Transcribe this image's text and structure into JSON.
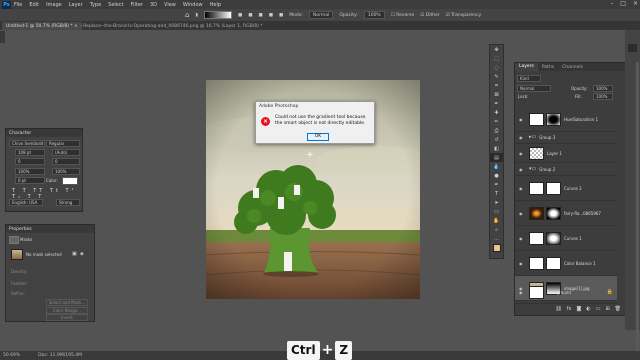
{
  "menubar": {
    "app_icon": "Ps",
    "items": [
      "File",
      "Edit",
      "Image",
      "Layer",
      "Type",
      "Select",
      "Filter",
      "3D",
      "View",
      "Window",
      "Help"
    ]
  },
  "options": {
    "mode_label": "Mode:",
    "mode_value": "Normal",
    "opacity_label": "Opacity:",
    "opacity_value": "100%",
    "reverse": "Reverse",
    "dither": "Dither",
    "transparency": "Transparency"
  },
  "tabs": {
    "active": "Untitled-1 @ 50.7% (RGB/8) * ×",
    "second": "--Replace--the-Brand-Is-Operating-and_0086746.png @ 16.7% (Layer 1, RGB/8) *"
  },
  "dialog": {
    "title": "Adobe Photoshop",
    "icon": "error-icon",
    "message": "Could not use the gradient tool because the smart object is not directly editable.",
    "ok": "OK"
  },
  "character": {
    "tab": "Character",
    "font": "Chivo Semibold",
    "style": "Regular",
    "size": "108 pt",
    "leading": "(Auto)",
    "kerning": "0",
    "tracking": "0",
    "vscale": "100%",
    "hscale": "100%",
    "baseline": "0 pt",
    "color_label": "Color:",
    "language": "English: USA",
    "aa": "Strong"
  },
  "properties": {
    "tab": "Properties",
    "tab2": "Masks",
    "layer_type": "Smart Object",
    "no_mask": "No mask selected",
    "density": "Density:",
    "feather": "Feather:",
    "refine": "Refine:",
    "select_mask": "Select and Mask...",
    "color_range": "Color Range...",
    "invert": "Invert"
  },
  "layers": {
    "tabs": [
      "Layers",
      "Paths",
      "Channels"
    ],
    "kind": "Kind",
    "blend": "Normal",
    "opacity_label": "Opacity:",
    "opacity": "100%",
    "lock_label": "Lock:",
    "fill_label": "Fill:",
    "fill": "100%",
    "rows": [
      {
        "name": "Hue/Saturation 1",
        "type": "adjust"
      },
      {
        "name": "Group 3",
        "type": "group"
      },
      {
        "name": "Layer 1",
        "type": "layer"
      },
      {
        "name": "Group 2",
        "type": "group"
      },
      {
        "name": "Curves 2",
        "type": "adjust"
      },
      {
        "name": "fairy-fla...0865967",
        "type": "image"
      },
      {
        "name": "Curves 1",
        "type": "adjust"
      },
      {
        "name": "Color Balance 1",
        "type": "adjust"
      },
      {
        "name": "image[1].jpg",
        "type": "smart"
      },
      {
        "name": "Background",
        "type": "bg"
      }
    ]
  },
  "status": {
    "zoom": "50.69%",
    "doc": "Doc: 11.9M/195.4M"
  },
  "shortcut": {
    "key1": "Ctrl",
    "plus": "+",
    "key2": "Z"
  },
  "colors": {
    "sky_top": "#b8b49a",
    "broccoli": "#4f8a2a",
    "ground": "#7a5338",
    "error_red": "#e81123"
  }
}
